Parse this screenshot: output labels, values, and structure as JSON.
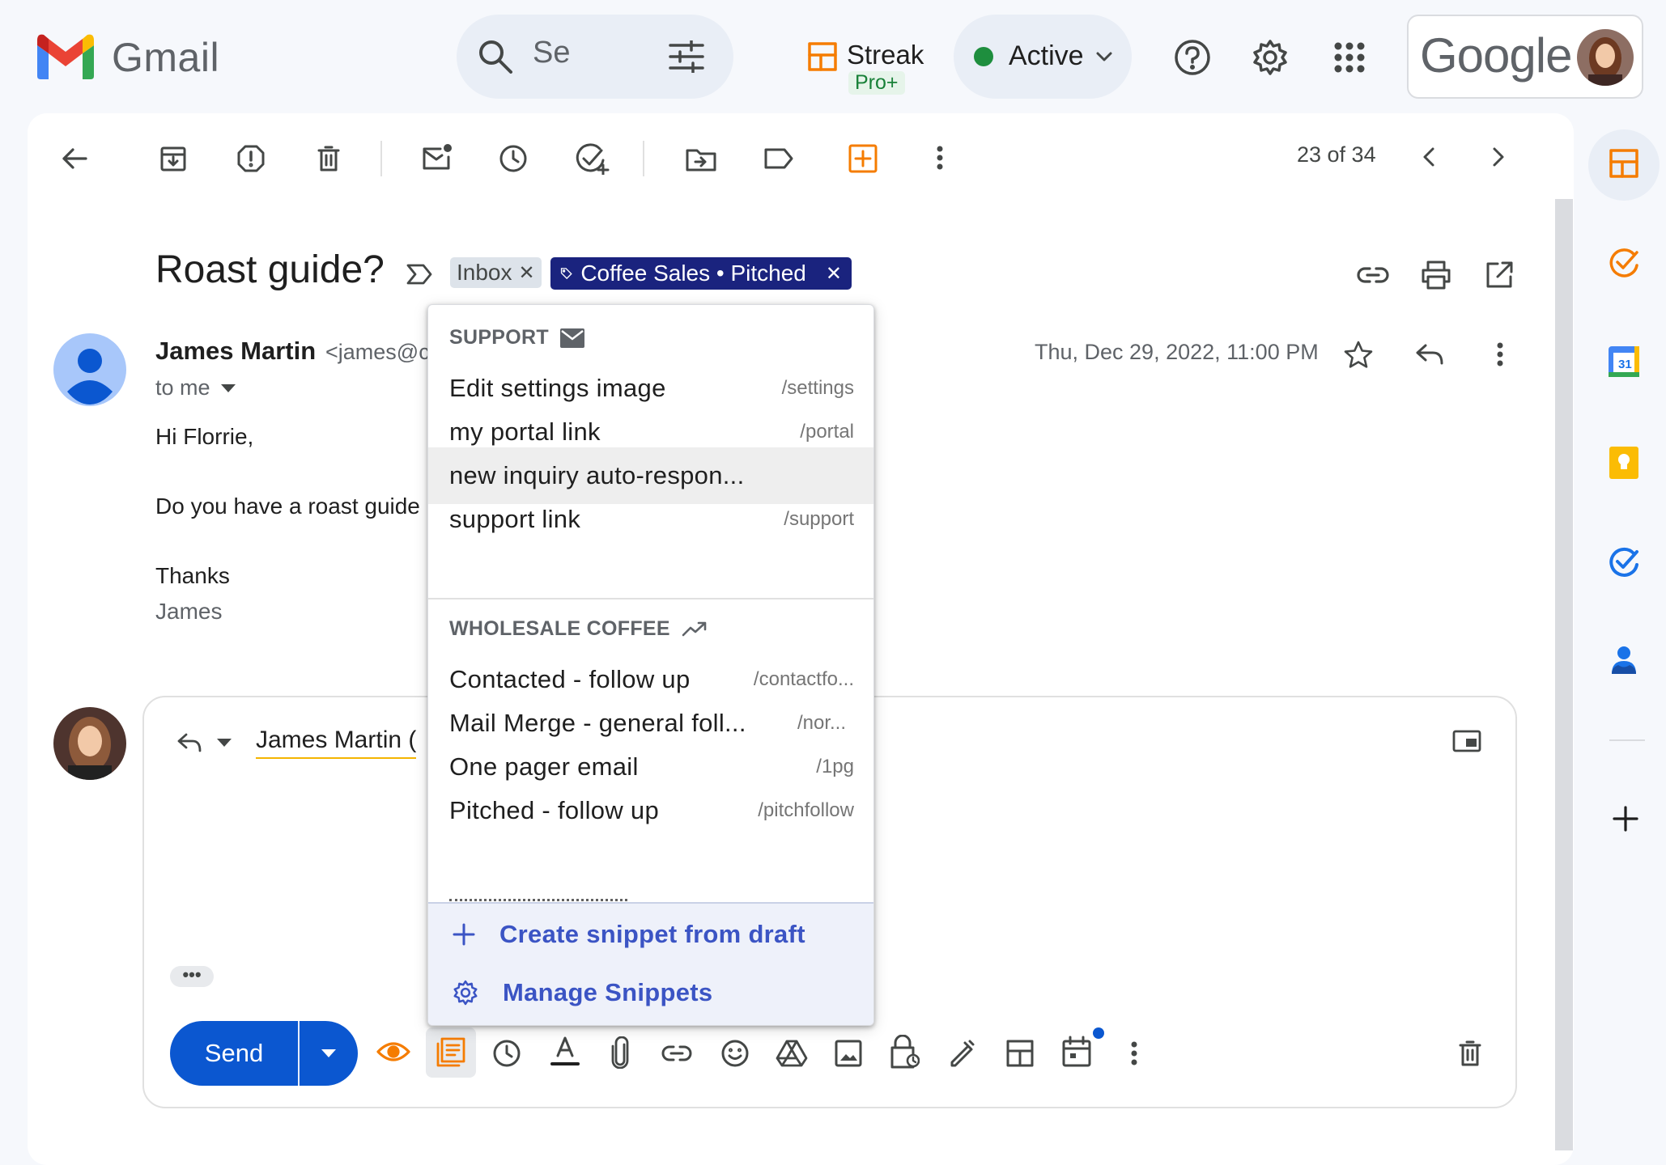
{
  "app": {
    "name": "Gmail"
  },
  "search": {
    "text": "Se"
  },
  "streak": {
    "name": "Streak",
    "badge": "Pro+"
  },
  "status": {
    "label": "Active",
    "color": "#1e8e3e"
  },
  "account": {
    "brand": "Google"
  },
  "toolbar": {
    "pager": "23 of 34"
  },
  "email": {
    "subject": "Roast guide?",
    "labels": {
      "inbox": "Inbox",
      "box": "Coffee Sales • Pitched"
    },
    "sender_name": "James Martin",
    "sender_email": "<james@c",
    "to": "to me",
    "date": "Thu, Dec 29, 2022, 11:00 PM",
    "body": [
      "Hi Florrie,",
      "Do you have a roast guide",
      "Thanks",
      "James"
    ]
  },
  "reply": {
    "recipient": "James Martin (",
    "send_label": "Send",
    "more_dots": "•••"
  },
  "snippets_menu": {
    "groups": [
      {
        "name": "SUPPORT",
        "icon": "mail-icon",
        "items": [
          {
            "title": "Edit settings image",
            "shortcut": "/settings"
          },
          {
            "title": "my portal link",
            "shortcut": "/portal"
          },
          {
            "title": "new inquiry auto-respon...",
            "shortcut": ""
          },
          {
            "title": "support link",
            "shortcut": "/support"
          }
        ]
      },
      {
        "name": "WHOLESALE COFFEE",
        "icon": "trending-icon",
        "items": [
          {
            "title": "Contacted - follow up",
            "shortcut": "/contactfo..."
          },
          {
            "title": "Mail Merge - general foll...",
            "shortcut": "/nor..."
          },
          {
            "title": "One pager email",
            "shortcut": "/1pg"
          },
          {
            "title": "Pitched - follow up",
            "shortcut": "/pitchfollow"
          }
        ]
      }
    ],
    "create_label": "Create snippet from draft",
    "manage_label": "Manage Snippets"
  },
  "colors": {
    "accent": "#0b57d0",
    "label_box": "#1a237e",
    "streak_orange": "#f57c00",
    "snippet_link": "#3b54c4"
  }
}
